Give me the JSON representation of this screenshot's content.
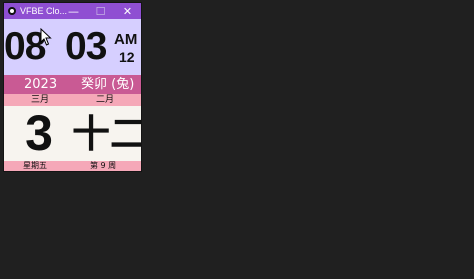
{
  "window": {
    "title": "VFBE Clo...",
    "controls": {
      "minimize_glyph": "—",
      "maximize_glyph": "☐",
      "close_glyph": "✕"
    }
  },
  "clock": {
    "hour": "08",
    "minute": "03",
    "ampm": "AM",
    "seconds": "12"
  },
  "calendar": {
    "year": "2023",
    "lunar_year": "癸卯 (兔)",
    "gregorian_month": "三月",
    "lunar_month": "二月",
    "day": "3",
    "lunar_day": "十二",
    "weekday": "星期五",
    "week_number": "第 9 周"
  },
  "colors": {
    "titlebar": "#8f4fd2",
    "time_background": "#d6cfff",
    "year_row": "#c95a94",
    "month_rows": "#f5a8b8",
    "day_background": "#f7f4ef"
  },
  "icons": {
    "app": "clock-app-icon",
    "cursor": "mouse-cursor-icon"
  }
}
